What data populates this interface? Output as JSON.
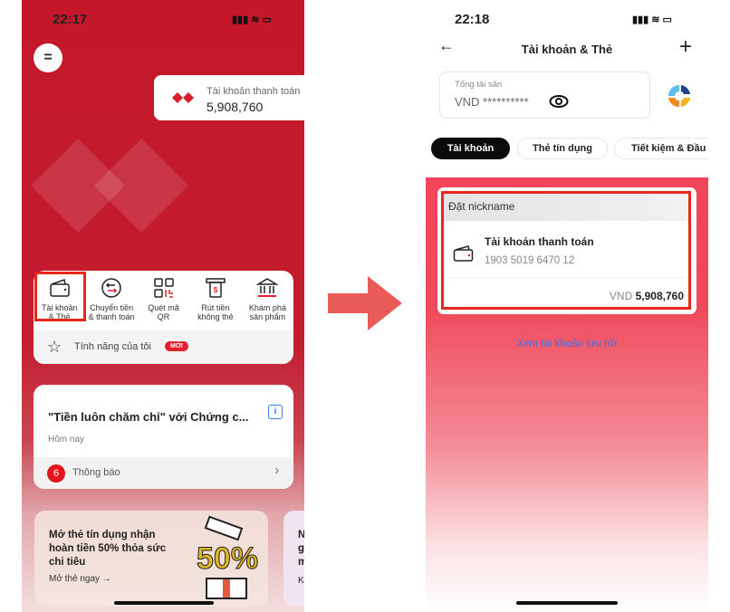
{
  "left_screen": {
    "status_time": "22:17",
    "menu_icon": "menu-icon",
    "account_summary": {
      "label": "Tài khoản thanh toán",
      "balance": "5,908,760"
    },
    "quick_actions": [
      {
        "line1": "Tài khoản",
        "line2": "& Thẻ",
        "icon": "wallet-icon"
      },
      {
        "line1": "Chuyển tiền",
        "line2": "& thanh toán",
        "icon": "transfer-icon"
      },
      {
        "line1": "Quét mã",
        "line2": "QR",
        "icon": "qr-icon"
      },
      {
        "line1": "Rút tiền",
        "line2": "không thẻ",
        "icon": "atm-icon"
      },
      {
        "line1": "Khám phá",
        "line2": "sản phẩm",
        "icon": "bank-icon"
      }
    ],
    "my_features": {
      "label": "Tính năng của tôi",
      "badge": "MỚI"
    },
    "news": {
      "title": "\"Tiền luôn chăm chỉ\" với Chứng c...",
      "date": "Hôm nay",
      "notif_count": "6",
      "notif_label": "Thông báo"
    },
    "promo": {
      "line1": "Mở thẻ tín dụng nhận",
      "line2": "hoàn tiền 50% thỏa sức",
      "line3": "chi tiêu",
      "cta": "Mở thẻ ngay →",
      "graphic_text": "50%"
    },
    "promo2": {
      "l1": "N",
      "l2": "g",
      "l3": "m",
      "l4": "Kł"
    }
  },
  "right_screen": {
    "status_time": "22:18",
    "title": "Tài khoản & Thẻ",
    "total_assets": {
      "label": "Tổng tài sản",
      "value": "VND **********"
    },
    "tabs": [
      "Tài khoản",
      "Thẻ tín dụng",
      "Tiết kiệm & Đầu t"
    ],
    "account_card": {
      "nickname": "Đặt nickname",
      "name": "Tài khoản thanh toán",
      "number": "1903 5019 6470 12",
      "currency": "VND",
      "balance": "5,908,760"
    },
    "archive_link": "Xem tài khoản lưu trữ"
  },
  "colors": {
    "brand_red": "#c4182a",
    "highlight": "#e8261a",
    "link_blue": "#4a6fe0",
    "right_bg": "#f2455a"
  }
}
